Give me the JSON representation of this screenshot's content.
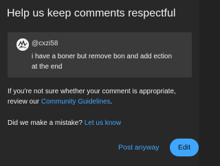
{
  "dialog": {
    "title": "Help us keep comments respectful",
    "comment": {
      "avatar_icon": "user-avatar-icon",
      "handle": "@cxzi58",
      "text": "i have a boner but remove bon and add ection at the end"
    },
    "info": {
      "prefix": "If you're not sure whether your comment is appropriate, review our",
      "link": "Community Guidelines",
      "suffix": "."
    },
    "mistake": {
      "prefix": "Did we make a mistake?",
      "link": "Let us know"
    },
    "buttons": {
      "post_anyway": "Post anyway",
      "edit": "Edit"
    },
    "colors": {
      "background": "#282828",
      "comment_box": "#3a3a3a",
      "accent": "#3ea6ff",
      "text": "#f1f1f1"
    }
  }
}
